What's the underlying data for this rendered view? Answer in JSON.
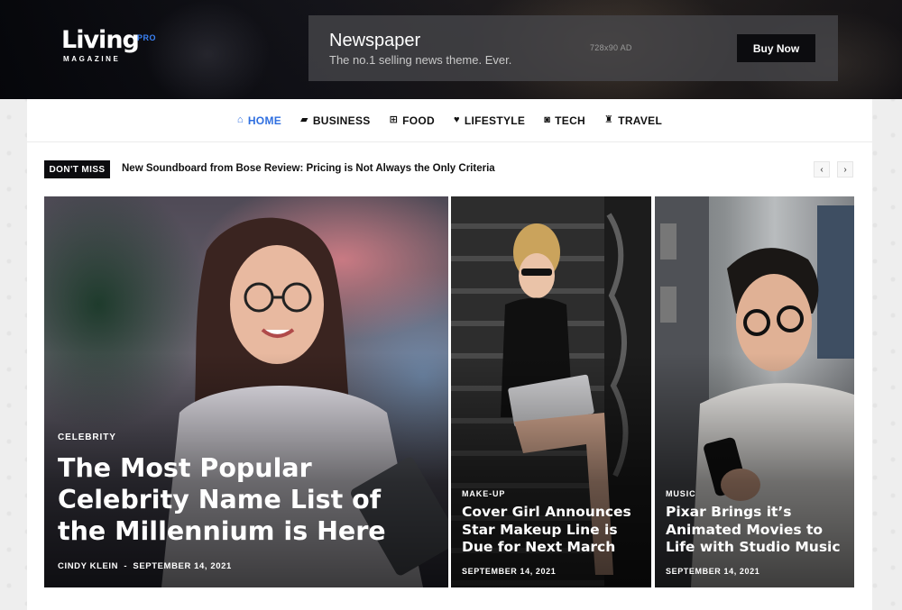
{
  "header": {
    "logo": {
      "main": "Living",
      "badge": "PRO",
      "sub": "MAGAZINE"
    },
    "ad": {
      "title": "Newspaper",
      "subtitle": "The no.1 selling news theme. Ever.",
      "size_label": "728x90 AD",
      "button": "Buy Now"
    }
  },
  "nav": {
    "items": [
      {
        "label": "HOME",
        "icon": "home-icon",
        "active": true
      },
      {
        "label": "BUSINESS",
        "icon": "business-icon",
        "active": false
      },
      {
        "label": "FOOD",
        "icon": "cart-icon",
        "active": false
      },
      {
        "label": "LIFESTYLE",
        "icon": "heart-icon",
        "active": false
      },
      {
        "label": "TECH",
        "icon": "camera-icon",
        "active": false
      },
      {
        "label": "TRAVEL",
        "icon": "travel-icon",
        "active": false
      }
    ]
  },
  "ticker": {
    "badge": "DON'T MISS",
    "headline": "New Soundboard from Bose Review: Pricing is Not Always the Only Criteria",
    "prev": "‹",
    "next": "›"
  },
  "featured": {
    "main": {
      "category": "CELEBRITY",
      "title": "The Most Popular Celebrity Name List of the Millennium is Here",
      "author": "CINDY KLEIN",
      "separator": "-",
      "date": "SEPTEMBER 14, 2021"
    },
    "middle": {
      "category": "MAKE-UP",
      "title": "Cover Girl Announces Star Makeup Line is Due for Next March",
      "date": "SEPTEMBER 14, 2021"
    },
    "right": {
      "category": "MUSIC",
      "title": "Pixar Brings it’s Animated Movies to Life with Studio Music",
      "date": "SEPTEMBER 14, 2021"
    }
  },
  "colors": {
    "accent": "#2f6fe0",
    "badge_bg": "#0c0c0f",
    "logo_pro": "#3b82f6"
  }
}
